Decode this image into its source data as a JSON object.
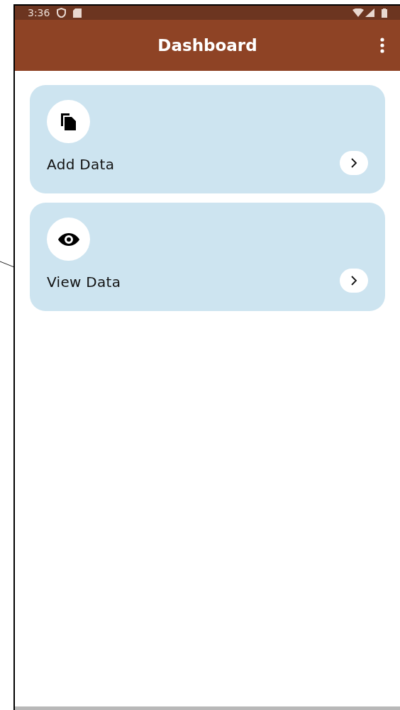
{
  "status_bar": {
    "time": "3:36"
  },
  "app_bar": {
    "title": "Dashboard"
  },
  "cards": [
    {
      "kind": "add",
      "label": "Add Data"
    },
    {
      "kind": "view",
      "label": "View Data"
    }
  ]
}
